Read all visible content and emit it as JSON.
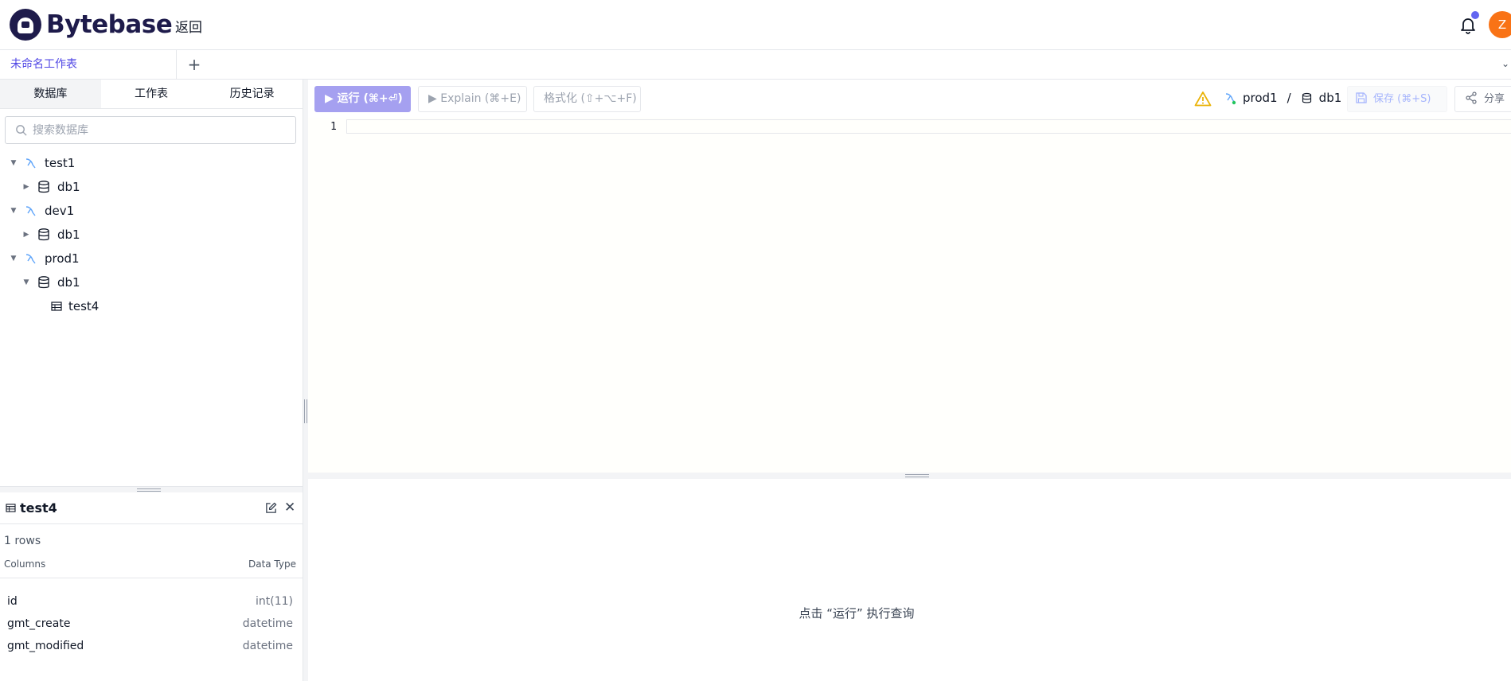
{
  "header": {
    "logo_text": "Bytebase",
    "back_label": "返回",
    "avatar_initial": "Z",
    "notification_dot_color": "#6366f1",
    "avatar_color": "#f97316"
  },
  "sheet_tabs": {
    "active_tab": "未命名工作表",
    "add_icon": "+"
  },
  "sidebar": {
    "tabs": [
      "数据库",
      "工作表",
      "历史记录"
    ],
    "active_tab_index": 0,
    "search_placeholder": "搜索数据库",
    "tree": [
      {
        "label": "test1",
        "type": "instance",
        "expanded": true,
        "depth": 0
      },
      {
        "label": "db1",
        "type": "database",
        "expanded": false,
        "depth": 1
      },
      {
        "label": "dev1",
        "type": "instance",
        "expanded": true,
        "depth": 0
      },
      {
        "label": "db1",
        "type": "database",
        "expanded": false,
        "depth": 1
      },
      {
        "label": "prod1",
        "type": "instance",
        "expanded": true,
        "depth": 0
      },
      {
        "label": "db1",
        "type": "database",
        "expanded": true,
        "depth": 1
      },
      {
        "label": "test4",
        "type": "table",
        "expanded": false,
        "depth": 2
      }
    ]
  },
  "table_panel": {
    "title": "test4",
    "rows_label": "1 rows",
    "columns_header": "Columns",
    "type_header": "Data Type",
    "columns": [
      {
        "name": "id",
        "type": "int(11)"
      },
      {
        "name": "gmt_create",
        "type": "datetime"
      },
      {
        "name": "gmt_modified",
        "type": "datetime"
      }
    ]
  },
  "toolbar": {
    "run_label": "▶ 运行 (⌘+⏎)",
    "explain_label": "▶ Explain (⌘+E)",
    "format_label": "格式化 (⇧+⌥+F)",
    "instance": "prod1",
    "separator": "/",
    "database": "db1",
    "save_label": "保存 (⌘+S)",
    "share_label": "分享",
    "accent_color": "#a5a0f0"
  },
  "editor": {
    "line_number": "1"
  },
  "result": {
    "hint": "点击 “运行” 执行查询"
  }
}
